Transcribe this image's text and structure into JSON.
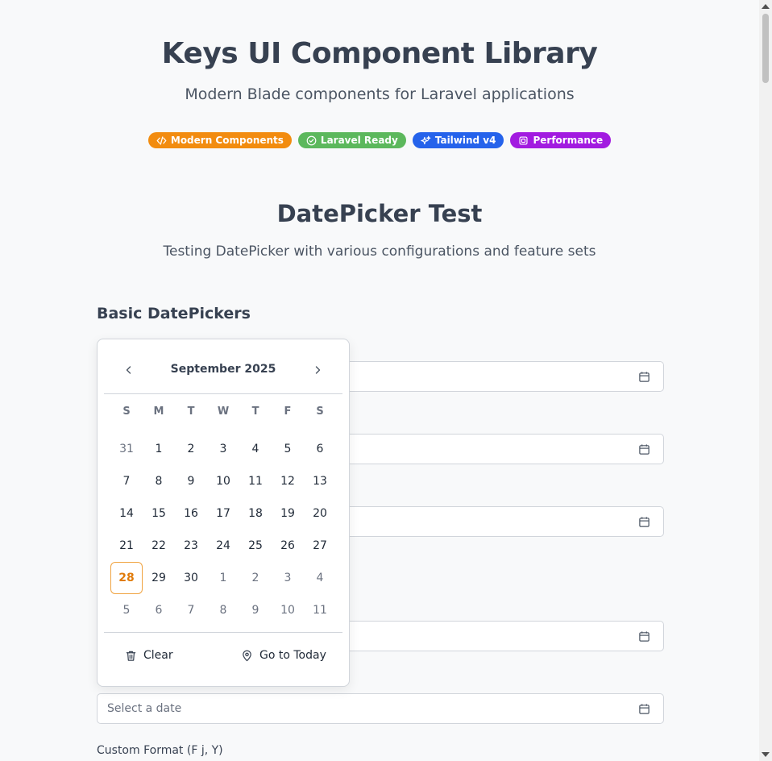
{
  "header": {
    "title": "Keys UI Component Library",
    "subtitle": "Modern Blade components for Laravel applications",
    "badges": [
      {
        "label": "Modern Components",
        "icon": "code-icon",
        "color": "#f28c0f"
      },
      {
        "label": "Laravel Ready",
        "icon": "check-circle-icon",
        "color": "#5cb85c"
      },
      {
        "label": "Tailwind v4",
        "icon": "sparkles-icon",
        "color": "#2563eb"
      },
      {
        "label": "Performance",
        "icon": "cpu-icon",
        "color": "#a21be0"
      }
    ]
  },
  "section": {
    "title": "DatePicker Test",
    "subtitle": "Testing DatePicker with various configurations and feature sets"
  },
  "group": {
    "title": "Basic DatePickers"
  },
  "fields": {
    "placeholder": "Select a date",
    "custom_format_label": "Custom Format (F j, Y)"
  },
  "calendar": {
    "month_label": "September 2025",
    "weekdays": [
      "S",
      "M",
      "T",
      "W",
      "T",
      "F",
      "S"
    ],
    "days": [
      {
        "d": "31",
        "muted": true
      },
      {
        "d": "1"
      },
      {
        "d": "2"
      },
      {
        "d": "3"
      },
      {
        "d": "4"
      },
      {
        "d": "5"
      },
      {
        "d": "6"
      },
      {
        "d": "7"
      },
      {
        "d": "8"
      },
      {
        "d": "9"
      },
      {
        "d": "10"
      },
      {
        "d": "11"
      },
      {
        "d": "12"
      },
      {
        "d": "13"
      },
      {
        "d": "14"
      },
      {
        "d": "15"
      },
      {
        "d": "16"
      },
      {
        "d": "17"
      },
      {
        "d": "18"
      },
      {
        "d": "19"
      },
      {
        "d": "20"
      },
      {
        "d": "21"
      },
      {
        "d": "22"
      },
      {
        "d": "23"
      },
      {
        "d": "24"
      },
      {
        "d": "25"
      },
      {
        "d": "26"
      },
      {
        "d": "27"
      },
      {
        "d": "28",
        "today": true
      },
      {
        "d": "29"
      },
      {
        "d": "30"
      },
      {
        "d": "1",
        "muted": true
      },
      {
        "d": "2",
        "muted": true
      },
      {
        "d": "3",
        "muted": true
      },
      {
        "d": "4",
        "muted": true
      },
      {
        "d": "5",
        "muted": true
      },
      {
        "d": "6",
        "muted": true
      },
      {
        "d": "7",
        "muted": true
      },
      {
        "d": "8",
        "muted": true
      },
      {
        "d": "9",
        "muted": true
      },
      {
        "d": "10",
        "muted": true
      },
      {
        "d": "11",
        "muted": true
      }
    ],
    "clear_label": "Clear",
    "today_label": "Go to Today"
  }
}
